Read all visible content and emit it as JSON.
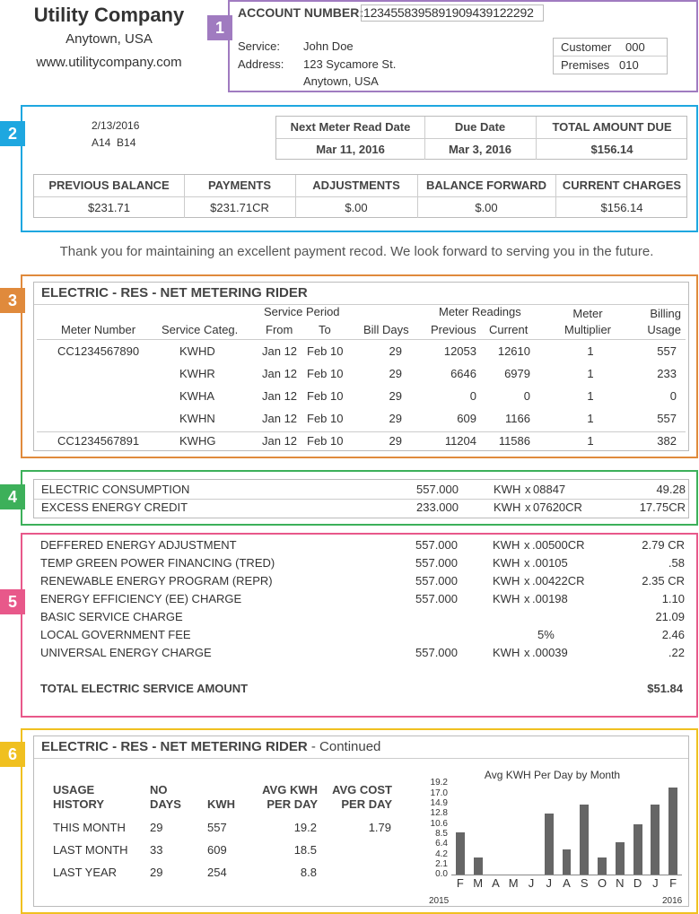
{
  "company": {
    "name": "Utility Company",
    "city": "Anytown, USA",
    "website": "www.utilitycompany.com"
  },
  "badges": [
    "1",
    "2",
    "3",
    "4",
    "5",
    "6"
  ],
  "colors": {
    "s1": "#a07bc0",
    "s2": "#1ea7e0",
    "s3": "#e08a3c",
    "s4": "#3db05a",
    "s5": "#e8588a",
    "s6": "#f0c020"
  },
  "account": {
    "label": "ACCOUNT NUMBER:",
    "number": "1234558395891909439122292",
    "service_label": "Service:",
    "service": "John Doe",
    "address_label": "Address:",
    "address1": "123 Sycamore St.",
    "address2": "Anytown, USA",
    "customer_label": "Customer",
    "customer": "000",
    "premises_label": "Premises",
    "premises": "010"
  },
  "summary": {
    "date": "2/13/2016",
    "codes": "A14  B14",
    "next_read_label": "Next Meter Read Date",
    "next_read": "Mar 11, 2016",
    "due_label": "Due Date",
    "due": "Mar 3, 2016",
    "total_label": "TOTAL AMOUNT DUE",
    "total": "$156.14",
    "headers": [
      "PREVIOUS BALANCE",
      "PAYMENTS",
      "ADJUSTMENTS",
      "BALANCE FORWARD",
      "CURRENT CHARGES"
    ],
    "values": [
      "$231.71",
      "$231.71CR",
      "$.00",
      "$.00",
      "$156.14"
    ]
  },
  "thanks": "Thank you for maintaining an excellent payment recod. We look forward to serving you in the future.",
  "meter": {
    "title": "ELECTRIC - RES - NET METERING RIDER",
    "service_period": "Service Period",
    "meter_readings": "Meter Readings",
    "h_meter_number": "Meter Number",
    "h_categ": "Service Categ.",
    "h_from": "From",
    "h_to": "To",
    "h_days": "Bill Days",
    "h_prev": "Previous",
    "h_curr": "Current",
    "h_mult1": "Meter",
    "h_mult2": "Multiplier",
    "h_usage1": "Billing",
    "h_usage2": "Usage",
    "rows": [
      {
        "meter": "CC1234567890",
        "categ": "KWHD",
        "from": "Jan 12",
        "to": "Feb 10",
        "days": "29",
        "prev": "12053",
        "curr": "12610",
        "mult": "1",
        "usage": "557"
      },
      {
        "meter": "",
        "categ": "KWHR",
        "from": "Jan 12",
        "to": "Feb 10",
        "days": "29",
        "prev": "6646",
        "curr": "6979",
        "mult": "1",
        "usage": "233"
      },
      {
        "meter": "",
        "categ": "KWHA",
        "from": "Jan 12",
        "to": "Feb 10",
        "days": "29",
        "prev": "0",
        "curr": "0",
        "mult": "1",
        "usage": "0"
      },
      {
        "meter": "",
        "categ": "KWHN",
        "from": "Jan 12",
        "to": "Feb 10",
        "days": "29",
        "prev": "609",
        "curr": "1166",
        "mult": "1",
        "usage": "557"
      },
      {
        "meter": "CC1234567891",
        "categ": "KWHG",
        "from": "Jan 12",
        "to": "Feb 10",
        "days": "29",
        "prev": "11204",
        "curr": "11586",
        "mult": "1",
        "usage": "382"
      }
    ]
  },
  "consumption": [
    {
      "label": "ELECTRIC CONSUMPTION",
      "qty": "557.000",
      "unit": "KWH",
      "x": "x",
      "rate": "08847",
      "amount": "49.28"
    },
    {
      "label": "EXCESS ENERGY CREDIT",
      "qty": "233.000",
      "unit": "KWH",
      "x": "x",
      "rate": "07620CR",
      "amount": "17.75CR"
    }
  ],
  "charges": [
    {
      "label": "DEFFERED ENERGY ADJUSTMENT",
      "qty": "557.000",
      "unit": "KWH",
      "x": "x",
      "rate": ".00500CR",
      "amount": "2.79 CR"
    },
    {
      "label": "TEMP GREEN POWER FINANCING (TRED)",
      "qty": "557.000",
      "unit": "KWH",
      "x": "x",
      "rate": ".00105",
      "amount": ".58"
    },
    {
      "label": "RENEWABLE ENERGY PROGRAM (REPR)",
      "qty": "557.000",
      "unit": "KWH",
      "x": "x",
      "rate": ".00422CR",
      "amount": "2.35 CR"
    },
    {
      "label": "ENERGY EFFICIENCY (EE) CHARGE",
      "qty": "557.000",
      "unit": "KWH",
      "x": "x",
      "rate": ".00198",
      "amount": "1.10"
    },
    {
      "label": "BASIC SERVICE CHARGE",
      "qty": "",
      "unit": "",
      "x": "",
      "rate": "",
      "amount": "21.09"
    },
    {
      "label": "LOCAL GOVERNMENT FEE",
      "qty": "",
      "unit": "",
      "x": "",
      "rate": "5%",
      "amount": "2.46"
    },
    {
      "label": "UNIVERSAL ENERGY CHARGE",
      "qty": "557.000",
      "unit": "KWH",
      "x": "x",
      "rate": ".00039",
      "amount": ".22"
    }
  ],
  "total_service": {
    "label": "TOTAL ELECTRIC SERVICE AMOUNT",
    "amount": "$51.84"
  },
  "history": {
    "title": "ELECTRIC - RES - NET METERING RIDER",
    "title_suffix": " - Continued",
    "h_usage1": "USAGE",
    "h_usage2": "HISTORY",
    "h_no1": "NO",
    "h_no2": "DAYS",
    "h_kwh": "KWH",
    "h_avgkwh1": "AVG KWH",
    "h_avgkwh2": "PER DAY",
    "h_avgcost1": "AVG COST",
    "h_avgcost2": "PER DAY",
    "rows": [
      {
        "label": "THIS MONTH",
        "days": "29",
        "kwh": "557",
        "avg": "19.2",
        "cost": "1.79"
      },
      {
        "label": "LAST MONTH",
        "days": "33",
        "kwh": "609",
        "avg": "18.5",
        "cost": ""
      },
      {
        "label": "LAST YEAR",
        "days": "29",
        "kwh": "254",
        "avg": "8.8",
        "cost": ""
      }
    ]
  },
  "chart_data": {
    "type": "bar",
    "title": "Avg KWH Per Day by Month",
    "categories": [
      "F",
      "M",
      "A",
      "M",
      "J",
      "J",
      "A",
      "S",
      "O",
      "N",
      "D",
      "J",
      "F"
    ],
    "values": [
      8.8,
      3.6,
      0,
      0,
      0,
      12.8,
      5.2,
      14.6,
      3.6,
      6.7,
      10.6,
      14.6,
      18.3
    ],
    "yticks": [
      "19.2",
      "17.0",
      "14.9",
      "12.8",
      "10.6",
      "8.5",
      "6.4",
      "4.2",
      "2.1",
      "0.0"
    ],
    "ylim": [
      0,
      19.2
    ],
    "year_start": "2015",
    "year_end": "2016"
  }
}
